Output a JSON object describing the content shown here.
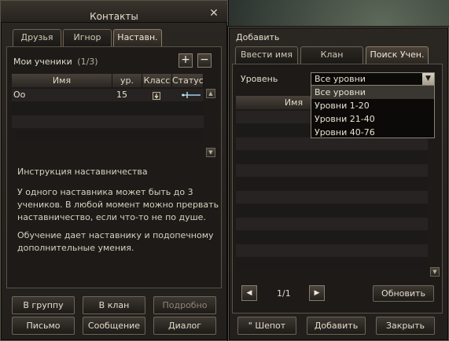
{
  "contacts": {
    "title": "Контакты",
    "tabs": [
      "Друзья",
      "Игнор",
      "Наставн."
    ],
    "active_tab": 2,
    "students_label": "Мои ученики",
    "students_count": "(1/3)",
    "table_headers": [
      "Имя",
      "ур.",
      "Класс",
      "Статус"
    ],
    "rows": [
      {
        "name": "Oo",
        "level": "15",
        "class_icon": "warrior-class-icon",
        "status_icon": "sword-icon"
      }
    ],
    "info_title": "Инструкция наставничества",
    "info_paragraph1": [
      "У одного наставника может быть до 3",
      "учеников. В любой момент можно прервать",
      "наставничество, если что-то не по душе."
    ],
    "info_paragraph2": [
      "Обучение дает наставнику и подопечному",
      "дополнительные умения."
    ],
    "buttons": {
      "to_group": "В группу",
      "to_clan": "В клан",
      "details": "Подробно",
      "mail": "Письмо",
      "message": "Сообщение",
      "dialog": "Диалог"
    }
  },
  "add": {
    "title": "Добавить",
    "tabs": [
      "Ввести имя",
      "Клан",
      "Поиск Учен."
    ],
    "active_tab": 2,
    "level_label": "Уровень",
    "level_selected": "Все уровни",
    "level_options": [
      "Все уровни",
      "Уровни 1-20",
      "Уровни 21-40",
      "Уровни 40-76"
    ],
    "table_header_name": "Имя",
    "page_indicator": "1/1",
    "refresh_label": "Обновить",
    "buttons": {
      "whisper": "\" Шепот",
      "add": "Добавить",
      "close": "Закрыть"
    }
  },
  "colors": {
    "frame": "#5a5247",
    "panel": "#241f1b",
    "text": "#d9d2c0"
  }
}
